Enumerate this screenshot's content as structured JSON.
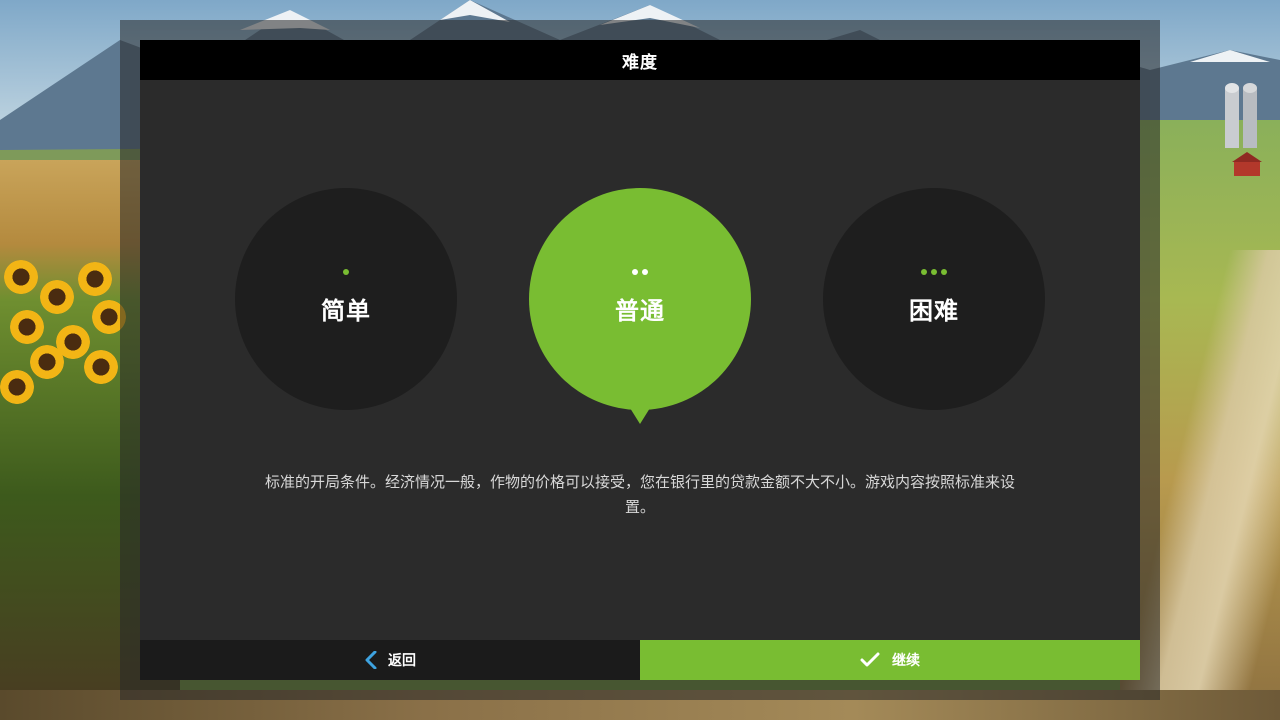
{
  "dialog": {
    "title": "难度"
  },
  "difficulty": {
    "options": [
      {
        "label": "简单",
        "dots": 1,
        "selected": false
      },
      {
        "label": "普通",
        "dots": 2,
        "selected": true
      },
      {
        "label": "困难",
        "dots": 3,
        "selected": false
      }
    ],
    "description": "标准的开局条件。经济情况一般，作物的价格可以接受，您在银行里的贷款金额不大不小。游戏内容按照标准来设置。"
  },
  "footer": {
    "back_label": "返回",
    "continue_label": "继续"
  },
  "icons": {
    "back": "chevron-left-icon",
    "continue": "checkmark-icon"
  },
  "colors": {
    "accent": "#79bd32",
    "back_icon": "#3ea3e0",
    "panel": "#2b2b2b",
    "circle": "#1e1e1e",
    "title_bar": "#000000"
  }
}
